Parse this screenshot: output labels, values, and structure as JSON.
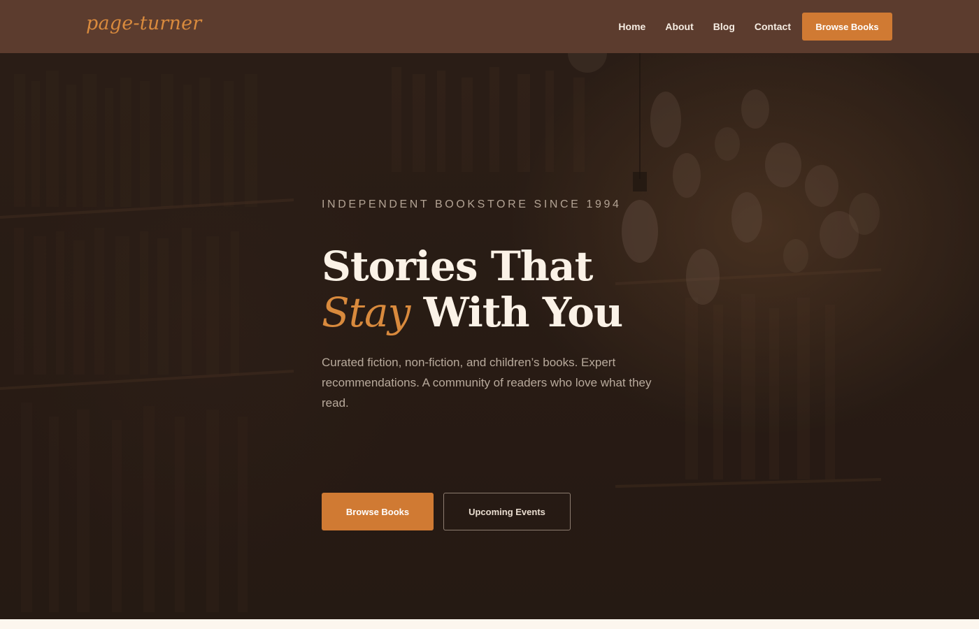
{
  "brand": {
    "logo": "page-turner"
  },
  "nav": {
    "links": [
      "Home",
      "About",
      "Blog",
      "Contact"
    ],
    "cta": "Browse Books"
  },
  "hero": {
    "eyebrow": "INDEPENDENT BOOKSTORE SINCE 1994",
    "headline_line1": "Stories That",
    "headline_accent": "Stay",
    "headline_rest": "With You",
    "description": "Curated fiction, non-fiction, and children’s books. Expert recommendations. A community of readers who love what they read.",
    "primary_button": "Browse Books",
    "secondary_button": "Upcoming Events"
  },
  "colors": {
    "nav_bg": "#5c3c2e",
    "accent": "#d07a33",
    "hero_bg": "#2c1f18",
    "headline": "#fbf2e7"
  }
}
